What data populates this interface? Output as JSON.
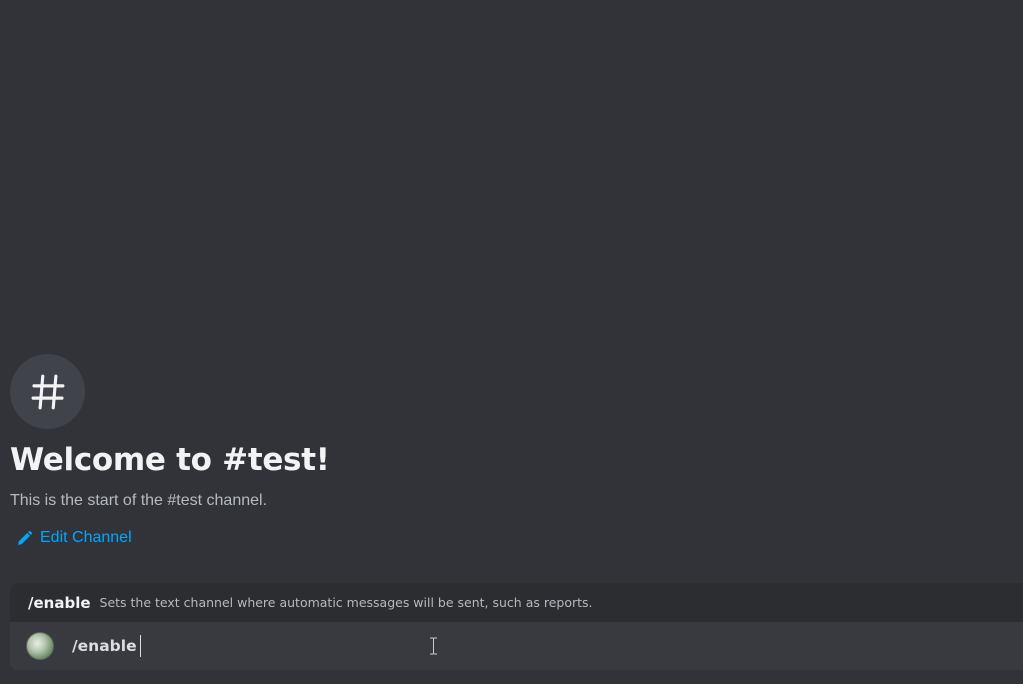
{
  "welcome": {
    "icon": "hash-icon",
    "title": "Welcome to #test!",
    "subtitle": "This is the start of the #test channel.",
    "edit_label": "Edit Channel"
  },
  "autocomplete": {
    "command": "/enable",
    "description": "Sets the text channel where automatic messages will be sent, such as reports."
  },
  "input": {
    "value": "/enable",
    "avatar": "app-avatar"
  },
  "colors": {
    "background": "#313338",
    "accent_link": "#00a8fc"
  }
}
